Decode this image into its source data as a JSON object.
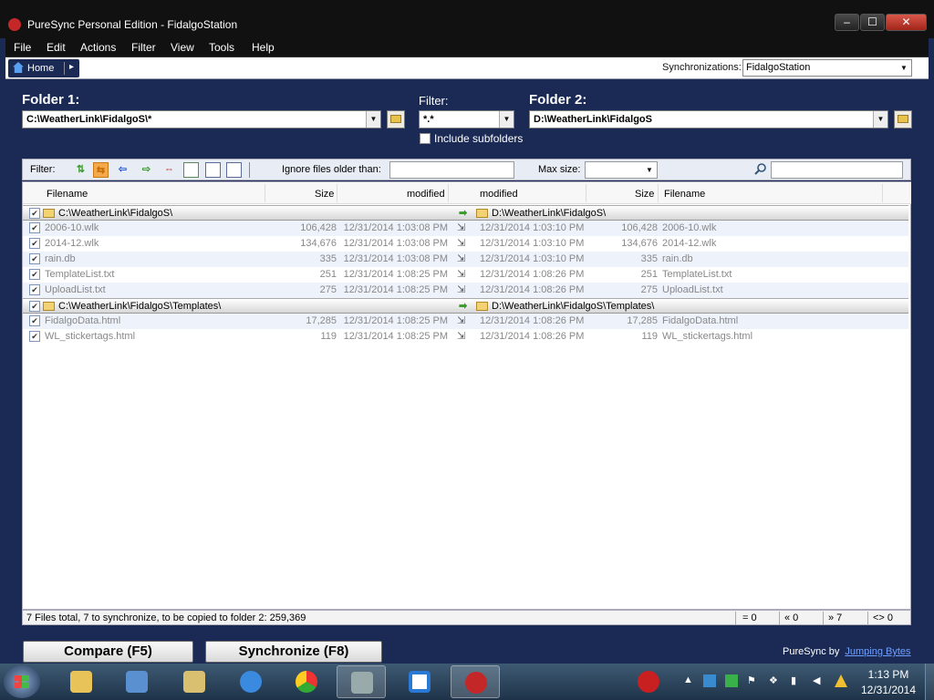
{
  "window": {
    "title": "PureSync Personal Edition  -  FidalgoStation",
    "min": "–",
    "max": "☐",
    "close": "✕"
  },
  "menu": [
    "File",
    "Edit",
    "Actions",
    "Filter",
    "View",
    "Tools",
    "Help"
  ],
  "nav": {
    "home": "Home",
    "sync_label": "Synchronizations:",
    "sync_value": "FidalgoStation"
  },
  "folder1": {
    "label": "Folder 1:",
    "value": "C:\\WeatherLink\\FidalgoS\\*"
  },
  "filter": {
    "label": "Filter:",
    "value": "*.*",
    "include_subfolders": "Include subfolders"
  },
  "folder2": {
    "label": "Folder 2:",
    "value": "D:\\WeatherLink\\FidalgoS"
  },
  "toolbar": {
    "filter": "Filter:",
    "ignore_label": "Ignore files older than:",
    "ignore_value": "",
    "maxsize_label": "Max size:",
    "maxsize_value": "",
    "search_value": ""
  },
  "columns": {
    "left_filename": "Filename",
    "left_size": "Size",
    "left_modified": "modified",
    "right_modified": "modified",
    "right_size": "Size",
    "right_filename": "Filename"
  },
  "rows": [
    {
      "type": "dir",
      "left": "C:\\WeatherLink\\FidalgoS\\",
      "right": "D:\\WeatherLink\\FidalgoS\\"
    },
    {
      "type": "file",
      "name1": "2006-10.wlk",
      "size1": "106,428",
      "mod1": "12/31/2014 1:03:08 PM",
      "mod2": "12/31/2014 1:03:10 PM",
      "size2": "106,428",
      "name2": "2006-10.wlk"
    },
    {
      "type": "file",
      "name1": "2014-12.wlk",
      "size1": "134,676",
      "mod1": "12/31/2014 1:03:08 PM",
      "mod2": "12/31/2014 1:03:10 PM",
      "size2": "134,676",
      "name2": "2014-12.wlk"
    },
    {
      "type": "file",
      "name1": "rain.db",
      "size1": "335",
      "mod1": "12/31/2014 1:03:08 PM",
      "mod2": "12/31/2014 1:03:10 PM",
      "size2": "335",
      "name2": "rain.db"
    },
    {
      "type": "file",
      "name1": "TemplateList.txt",
      "size1": "251",
      "mod1": "12/31/2014 1:08:25 PM",
      "mod2": "12/31/2014 1:08:26 PM",
      "size2": "251",
      "name2": "TemplateList.txt"
    },
    {
      "type": "file",
      "name1": "UploadList.txt",
      "size1": "275",
      "mod1": "12/31/2014 1:08:25 PM",
      "mod2": "12/31/2014 1:08:26 PM",
      "size2": "275",
      "name2": "UploadList.txt"
    },
    {
      "type": "dir",
      "left": "C:\\WeatherLink\\FidalgoS\\Templates\\",
      "right": "D:\\WeatherLink\\FidalgoS\\Templates\\"
    },
    {
      "type": "file",
      "name1": "FidalgoData.html",
      "size1": "17,285",
      "mod1": "12/31/2014 1:08:25 PM",
      "mod2": "12/31/2014 1:08:26 PM",
      "size2": "17,285",
      "name2": "FidalgoData.html"
    },
    {
      "type": "file",
      "name1": "WL_stickertags.html",
      "size1": "119",
      "mod1": "12/31/2014 1:08:25 PM",
      "mod2": "12/31/2014 1:08:26 PM",
      "size2": "119",
      "name2": "WL_stickertags.html"
    }
  ],
  "status": {
    "summary": "7 Files total,  7 to synchronize,  to be copied to folder 2: 259,369",
    "equal": "= 0",
    "older": "« 0",
    "newer": "» 7",
    "diff": "<> 0"
  },
  "buttons": {
    "compare": "Compare (F5)",
    "synchronize": "Synchronize (F8)"
  },
  "brand": {
    "text": "PureSync by",
    "link": "Jumping Bytes"
  },
  "clock": {
    "time": "1:13 PM",
    "date": "12/31/2014"
  },
  "taskbar_icons": [
    "explorer-icon",
    "network-icon",
    "outlook-icon",
    "ie-icon",
    "chrome-icon",
    "weatherlink-icon",
    "dropbox-icon",
    "puresync-icon"
  ],
  "colors": {
    "frame": "#1b2a55",
    "taskbar": "#2d4760",
    "accent": "#3a9a2a"
  }
}
